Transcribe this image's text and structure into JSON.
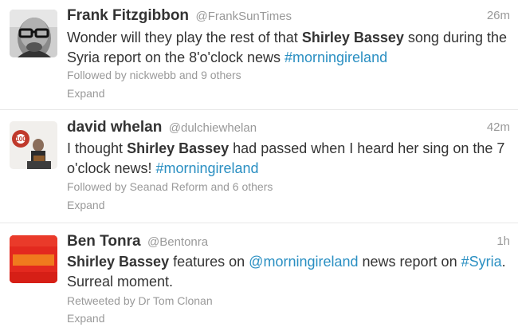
{
  "tweets": [
    {
      "fullname": "Frank Fitzgibbon",
      "username": "@FrankSunTimes",
      "time": "26m",
      "text": {
        "t1": "Wonder will they play the rest of that ",
        "b1": "Shirley Bassey",
        "t2": " song during the Syria report on the 8'o'clock news ",
        "h1": "#morningireland"
      },
      "context": "Followed by nickwebb and 9 others",
      "expand": "Expand"
    },
    {
      "fullname": "david whelan",
      "username": "@dulchiewhelan",
      "time": "42m",
      "avatar_sign": "100",
      "text": {
        "t1": "I thought ",
        "b1": "Shirley Bassey",
        "t2": " had passed when I heard her sing on the 7 o'clock news! ",
        "h1": "#morningireland"
      },
      "context": "Followed by Seanad Reform and 6 others",
      "expand": "Expand"
    },
    {
      "fullname": "Ben Tonra",
      "username": "@Bentonra",
      "time": "1h",
      "text": {
        "b1": "Shirley Bassey",
        "t1": " features on ",
        "m1": "@morningireland",
        "t2": " news report on ",
        "h1": "#Syria",
        "t3": ". Surreal moment."
      },
      "context": "Retweeted by Dr Tom Clonan",
      "expand": "Expand"
    }
  ],
  "colors": {
    "link": "#2a8fc2",
    "meta": "#999999",
    "name": "#333333"
  }
}
